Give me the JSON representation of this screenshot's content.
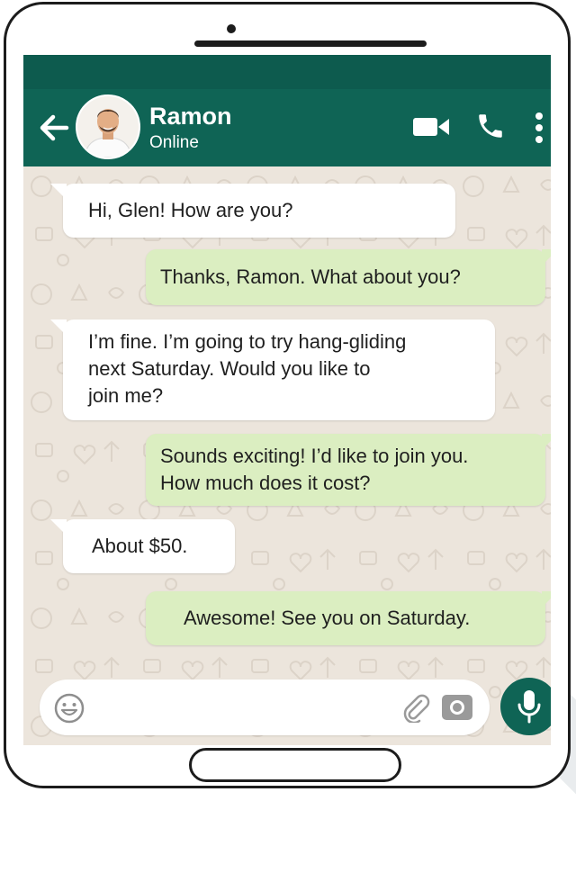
{
  "header": {
    "contact_name": "Ramon",
    "contact_status": "Online"
  },
  "messages": [
    {
      "direction": "incoming",
      "text": "Hi, Glen! How are you?"
    },
    {
      "direction": "outgoing",
      "text": "Thanks, Ramon. What about you?"
    },
    {
      "direction": "incoming",
      "text": "I’m fine. I’m going to try hang-gliding\nnext Saturday. Would you like to\njoin me?"
    },
    {
      "direction": "outgoing",
      "text": "Sounds exciting! I’d like to join you.\nHow much does it cost?"
    },
    {
      "direction": "incoming",
      "text": "About $50."
    },
    {
      "direction": "outgoing",
      "text": "Awesome! See you on Saturday."
    }
  ],
  "composer": {
    "placeholder": ""
  },
  "icons": {
    "back": "arrow-left-icon",
    "video": "video-camera-icon",
    "call": "phone-icon",
    "menu": "more-vertical-icon",
    "emoji": "emoji-icon",
    "attach": "paperclip-icon",
    "camera": "camera-icon",
    "mic": "microphone-icon"
  },
  "colors": {
    "header": "#0f6455",
    "status_bar": "#0d5b4e",
    "chat_background": "#ece5dc",
    "incoming_bubble": "#ffffff",
    "outgoing_bubble": "#dbeec1",
    "mic_button": "#0f6455"
  }
}
